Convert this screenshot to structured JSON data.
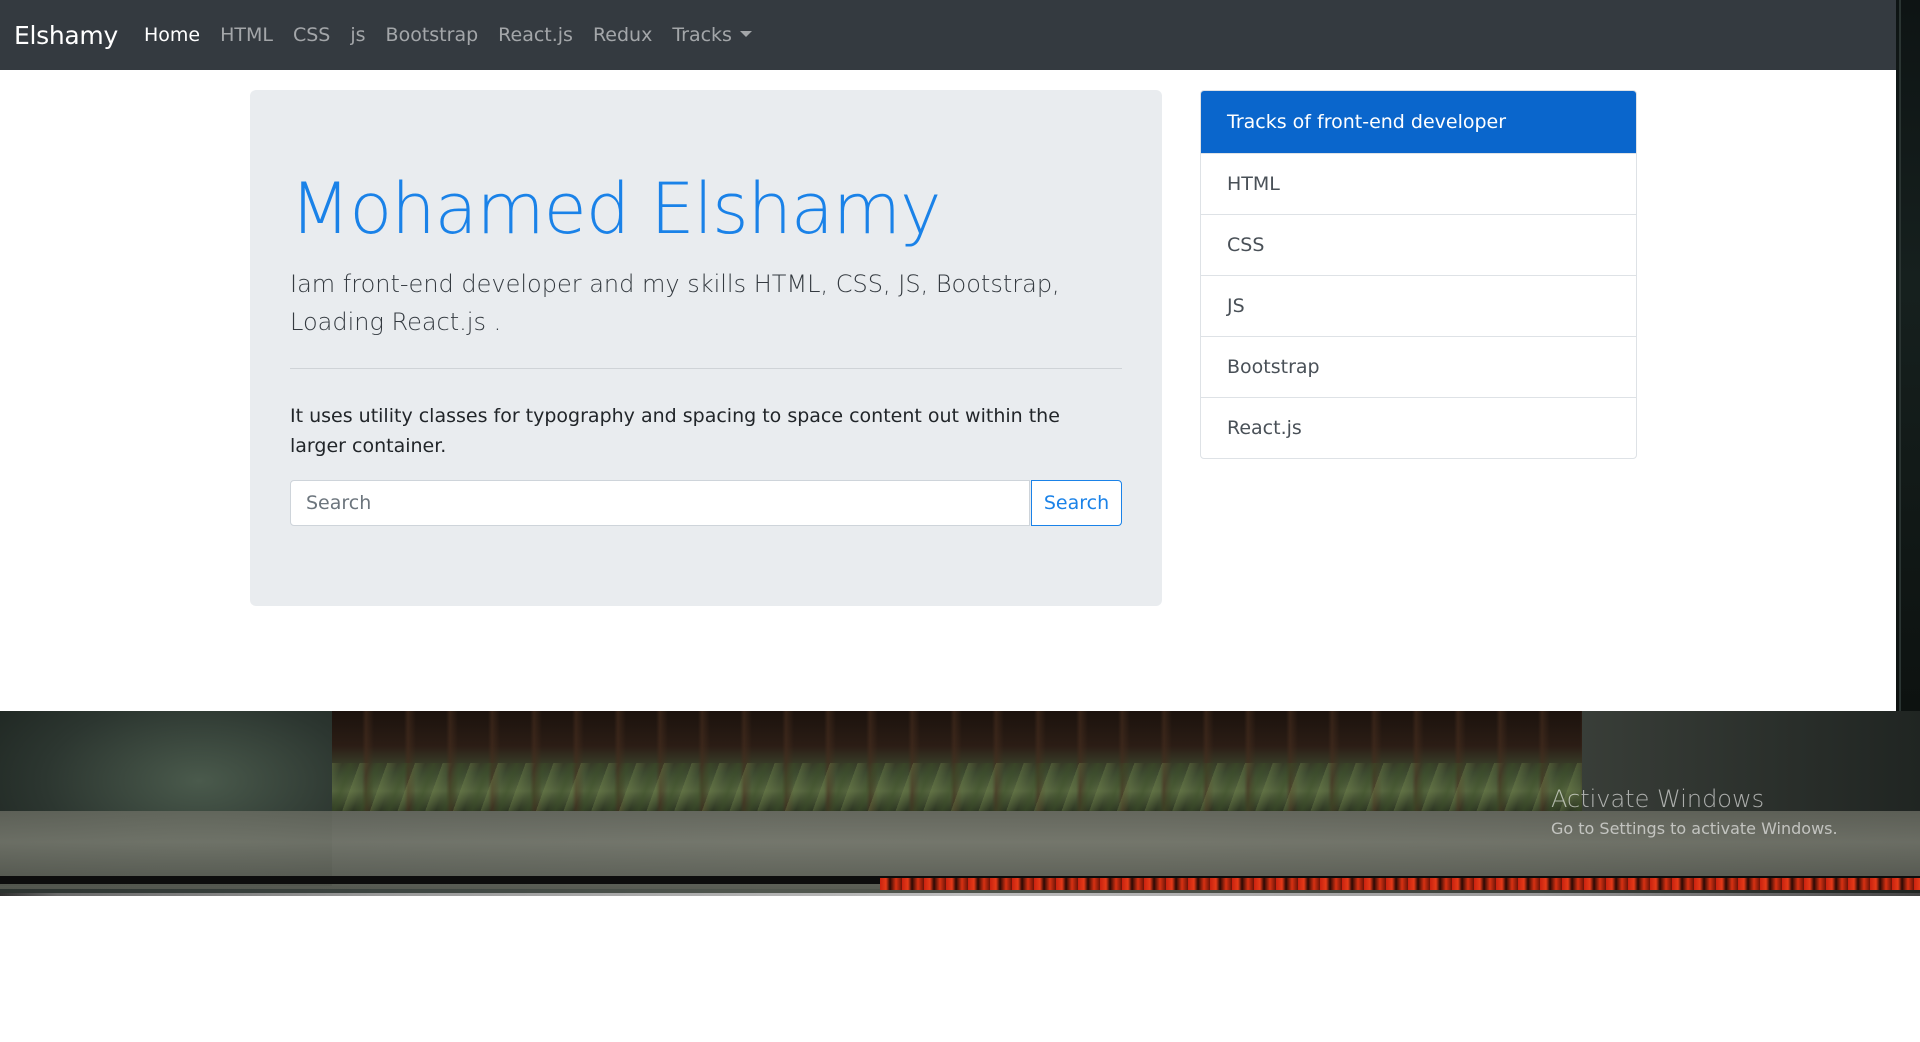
{
  "navbar": {
    "brand": "Elshamy",
    "links": [
      {
        "label": "Home",
        "active": true
      },
      {
        "label": "HTML"
      },
      {
        "label": "CSS"
      },
      {
        "label": "js"
      },
      {
        "label": "Bootstrap"
      },
      {
        "label": "React.js"
      },
      {
        "label": "Redux"
      },
      {
        "label": "Tracks",
        "dropdown": true
      }
    ],
    "colors": {
      "background": "#343a40",
      "active": "#ffffff",
      "inactive": "rgba(255,255,255,0.55)"
    }
  },
  "jumbotron": {
    "title": "Mohamed Elshamy",
    "lead": "Iam front-end developer and my skills HTML, CSS, JS, Bootstrap, Loading React.js .",
    "body": "It uses utility classes for typography and spacing to space content out within the larger container.",
    "search": {
      "placeholder": "Search",
      "value": "",
      "button_label": "Search"
    },
    "colors": {
      "background": "#e9ecef",
      "title": "#1a82e8"
    }
  },
  "tracks": {
    "header": "Tracks of front-end developer",
    "items": [
      "HTML",
      "CSS",
      "JS",
      "Bootstrap",
      "React.js"
    ],
    "colors": {
      "header_background": "#0a66cc"
    }
  },
  "desktop_overlay": {
    "title": "Activate Windows",
    "subtitle": "Go to Settings to activate Windows."
  }
}
